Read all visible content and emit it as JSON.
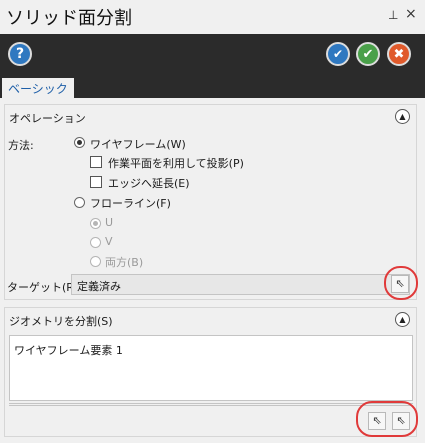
{
  "window": {
    "title": "ソリッド面分割",
    "pin_glyph": "ᵖ",
    "close_glyph": "×"
  },
  "toolbar": {
    "help": "?",
    "apply": "✔",
    "ok": "✔",
    "cancel": "✖"
  },
  "tabs": [
    {
      "label": "ベーシック",
      "active": true
    }
  ],
  "operation": {
    "title": "オペレーション",
    "method_label": "方法:",
    "wireframe": {
      "label": "ワイヤフレーム(W)",
      "selected": true
    },
    "project_plane": {
      "label": "作業平面を利用して投影(P)",
      "checked": false
    },
    "extend_edge": {
      "label": "エッジへ延長(E)",
      "checked": false
    },
    "flowline": {
      "label": "フローライン(F)",
      "selected": false
    },
    "u": {
      "label": "U",
      "selected": true,
      "enabled": false
    },
    "v": {
      "label": "V",
      "selected": false,
      "enabled": false
    },
    "both": {
      "label": "両方(B)",
      "selected": false,
      "enabled": false
    },
    "target_label": "ターゲット(R):",
    "target_value": "定義済み"
  },
  "split_geometry": {
    "title": "ジオメトリを分割(S)",
    "items": [
      "ワイヤフレーム要素 1"
    ]
  },
  "colors": {
    "toolbar_bg": "#2b2b2b",
    "accent_blue": "#2f78c0",
    "highlight_ring": "#e03a3a"
  }
}
